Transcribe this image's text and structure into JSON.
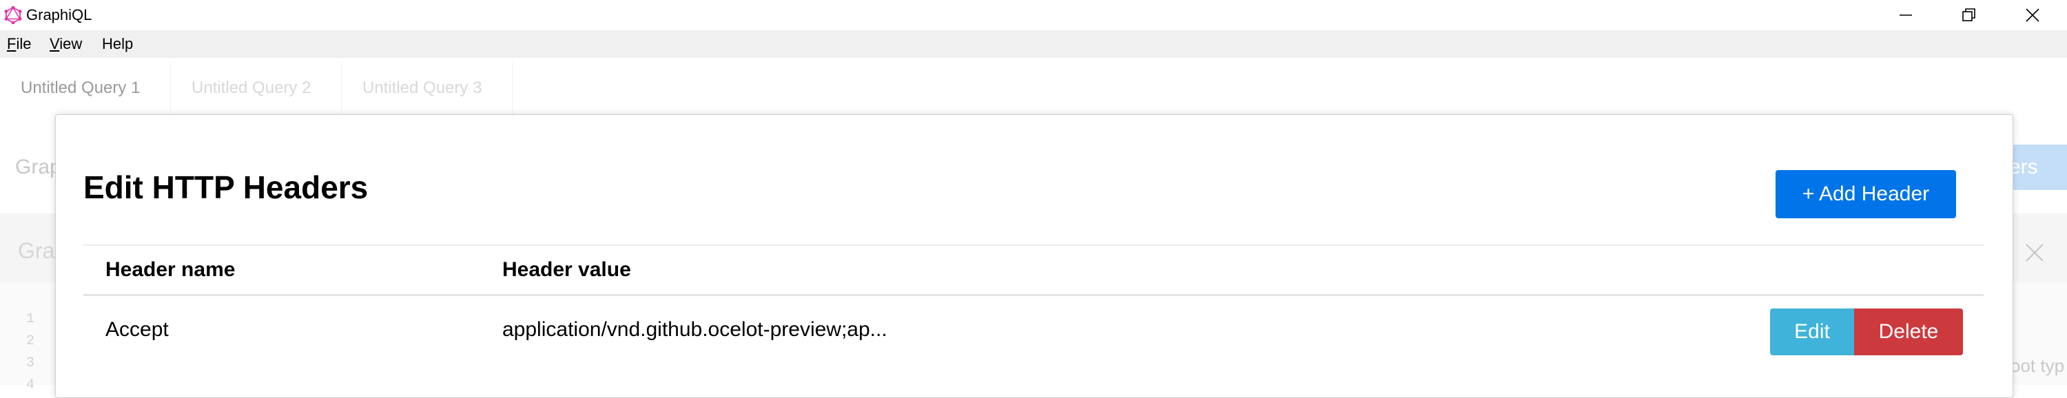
{
  "window": {
    "title": "GraphiQL",
    "icon": "graphql-logo-icon",
    "controls": [
      "minimize-icon",
      "restore-icon",
      "close-icon"
    ]
  },
  "menu": {
    "items": [
      {
        "label": "File",
        "underline": "F",
        "rest": "ile"
      },
      {
        "label": "View",
        "underline": "V",
        "rest": "iew"
      },
      {
        "label": "Help",
        "underline": "",
        "rest": "Help"
      }
    ]
  },
  "tabs": [
    {
      "label": "Untitled Query 1"
    },
    {
      "label": "Untitled Query 2"
    },
    {
      "label": "Untitled Query 3"
    }
  ],
  "background": {
    "toolbar_text": "Grap",
    "headers_button_text": "ers",
    "pane_title": "Gra",
    "line_numbers": [
      "1",
      "2",
      "3",
      "4"
    ],
    "hint_text": "oot typ"
  },
  "modal": {
    "title": "Edit HTTP Headers",
    "add_button": "+ Add Header",
    "columns": {
      "name": "Header name",
      "value": "Header value"
    },
    "rows": [
      {
        "name": "Accept",
        "value": "application/vnd.github.ocelot-preview;ap...",
        "edit_label": "Edit",
        "delete_label": "Delete"
      }
    ]
  },
  "colors": {
    "primary": "#0074e8",
    "info": "#3fb3d9",
    "danger": "#cc3a3e",
    "graphql_pink": "#e535ab"
  }
}
